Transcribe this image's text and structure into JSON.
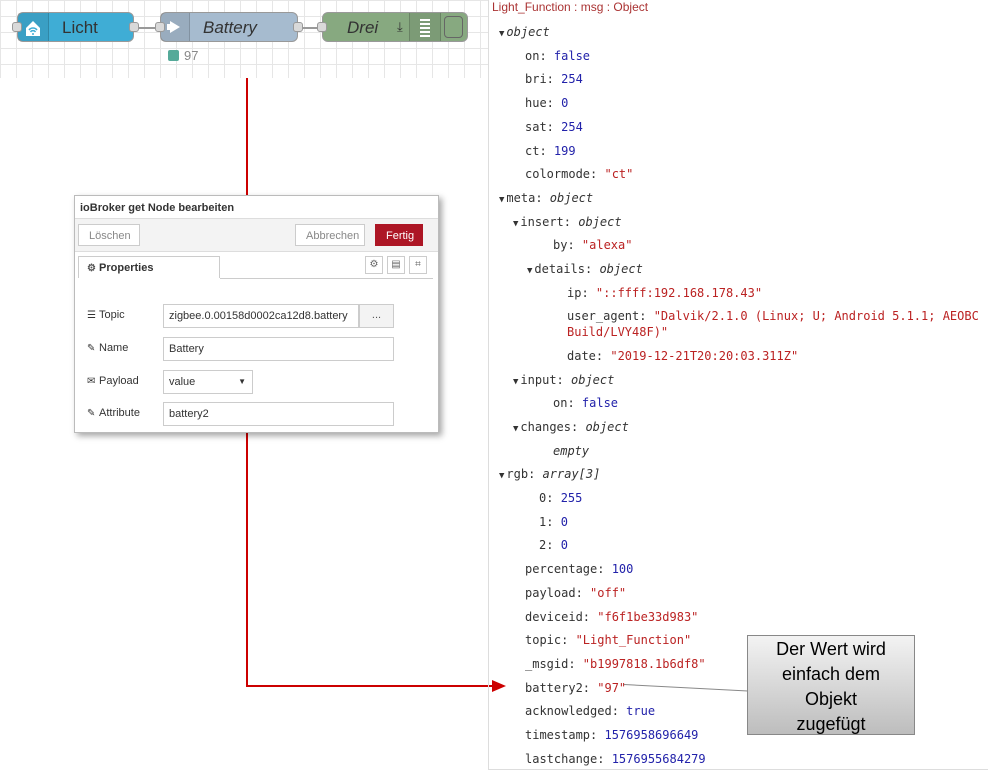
{
  "flow": {
    "nodes": [
      {
        "label": "Licht",
        "icon": "wifi-home-icon",
        "color": "#3fadd5"
      },
      {
        "label": "Battery",
        "icon": "arrow-right-icon",
        "color": "#a6bbcf"
      },
      {
        "label": "Drei",
        "icon": "debug-list-icon",
        "color": "#87a980"
      }
    ],
    "status_text": "97",
    "status_color": "#5a9"
  },
  "dialog": {
    "title": "ioBroker get Node bearbeiten",
    "delete_label": "Löschen",
    "cancel_label": "Abbrechen",
    "done_label": "Fertig",
    "tab_label": "Properties",
    "dot_label": "...",
    "fields": {
      "topic": {
        "label": "Topic",
        "value": "zigbee.0.00158d0002ca12d8.battery"
      },
      "name": {
        "label": "Name",
        "value": "Battery"
      },
      "payload": {
        "label": "Payload",
        "value": "value"
      },
      "attribute": {
        "label": "Attribute",
        "value": "battery2"
      }
    }
  },
  "debug": {
    "header": "Light_Function : msg : Object",
    "lines": [
      {
        "k": "object",
        "type": "t",
        "toggle": true,
        "indent": 0
      },
      {
        "k": "on",
        "v": "false",
        "type": "b",
        "indent": 1
      },
      {
        "k": "bri",
        "v": "254",
        "type": "n",
        "indent": 1
      },
      {
        "k": "hue",
        "v": "0",
        "type": "n",
        "indent": 1
      },
      {
        "k": "sat",
        "v": "254",
        "type": "n",
        "indent": 1
      },
      {
        "k": "ct",
        "v": "199",
        "type": "n",
        "indent": 1
      },
      {
        "k": "colormode",
        "v": "\"ct\"",
        "type": "s",
        "indent": 1
      },
      {
        "k": "meta",
        "v": "object",
        "type": "t",
        "toggle": true,
        "indent": 0
      },
      {
        "k": "insert",
        "v": "object",
        "type": "t",
        "toggle": true,
        "indent": 1
      },
      {
        "k": "by",
        "v": "\"alexa\"",
        "type": "s",
        "indent": 3
      },
      {
        "k": "details",
        "v": "object",
        "type": "t",
        "toggle": true,
        "indent": 2
      },
      {
        "k": "ip",
        "v": "\"::ffff:192.168.178.43\"",
        "type": "s",
        "indent": 4
      },
      {
        "k": "user_agent",
        "v": "\"Dalvik/2.1.0 (Linux; U; Android 5.1.1; AEOBC",
        "v2": "Build/LVY48F)\"",
        "type": "s",
        "indent": 4
      },
      {
        "k": "date",
        "v": "\"2019-12-21T20:20:03.311Z\"",
        "type": "s",
        "indent": 4
      },
      {
        "k": "input",
        "v": "object",
        "type": "t",
        "toggle": true,
        "indent": 1
      },
      {
        "k": "on",
        "v": "false",
        "type": "b",
        "indent": 3
      },
      {
        "k": "changes",
        "v": "object",
        "type": "t",
        "toggle": true,
        "indent": 1
      },
      {
        "k": "",
        "v": "empty",
        "type": "t",
        "indent": 3
      },
      {
        "k": "rgb",
        "v": "array[3]",
        "type": "t",
        "toggle": true,
        "indent": 0
      },
      {
        "k": "0",
        "v": "255",
        "type": "n",
        "indent": 2
      },
      {
        "k": "1",
        "v": "0",
        "type": "n",
        "indent": 2
      },
      {
        "k": "2",
        "v": "0",
        "type": "n",
        "indent": 2
      },
      {
        "k": "percentage",
        "v": "100",
        "type": "n",
        "indent": 1
      },
      {
        "k": "payload",
        "v": "\"off\"",
        "type": "s",
        "indent": 1
      },
      {
        "k": "deviceid",
        "v": "\"f6f1be33d983\"",
        "type": "s",
        "indent": 1
      },
      {
        "k": "topic",
        "v": "\"Light_Function\"",
        "type": "s",
        "indent": 1
      },
      {
        "k": "_msgid",
        "v": "\"b1997818.1b6df8\"",
        "type": "s",
        "indent": 1
      },
      {
        "k": "battery2",
        "v": "\"97\"",
        "type": "s",
        "indent": 1
      },
      {
        "k": "acknowledged",
        "v": "true",
        "type": "b",
        "indent": 1
      },
      {
        "k": "timestamp",
        "v": "1576958696649",
        "type": "n",
        "indent": 1
      },
      {
        "k": "lastchange",
        "v": "1576955684279",
        "type": "n",
        "indent": 1
      }
    ]
  },
  "annotation": {
    "lines": [
      "Der Wert wird",
      "einfach dem",
      "Objekt",
      "zugefügt"
    ]
  },
  "colors": {
    "arrow": "#cc0000",
    "fertig": "#ad1625"
  }
}
